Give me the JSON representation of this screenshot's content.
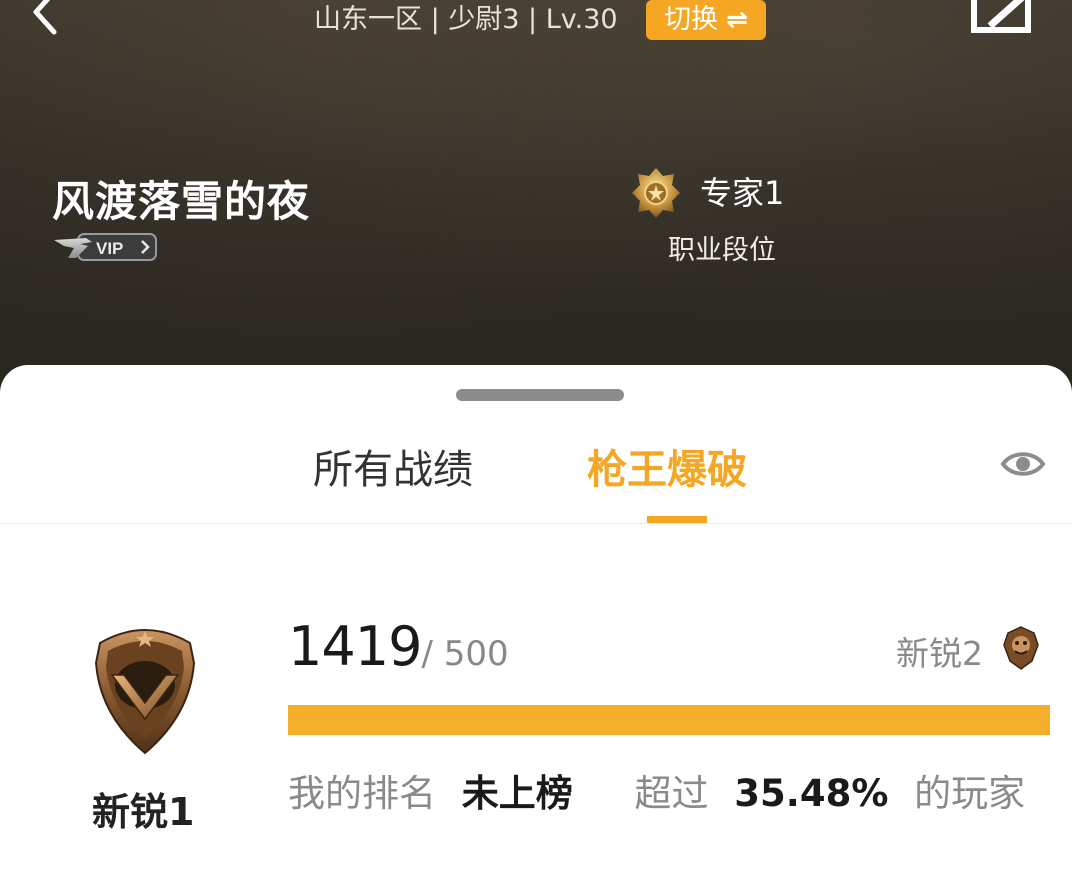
{
  "header": {
    "server_info": "山东一区 | 少尉3 | Lv.30",
    "switch_label": "切换",
    "switch_icon": "⇌",
    "username": "风渡落雪的夜",
    "vip_label": "VIP",
    "pro_rank": "专家1",
    "pro_label": "职业段位",
    "icons": [
      "back-icon",
      "edit-icon",
      "vip-badge-icon",
      "pro-medal-icon"
    ]
  },
  "tabs": [
    {
      "label": "所有战绩",
      "active": false
    },
    {
      "label": "枪王爆破",
      "active": true
    }
  ],
  "rank": {
    "current_name": "新锐1",
    "score": "1419",
    "score_max": "/ 500",
    "progress_fraction": 1.0,
    "next_rank": "新锐2",
    "my_rank_label": "我的排名",
    "my_rank_value": "未上榜",
    "exceed_label": "超过",
    "exceed_value": "35.48%",
    "players_label": "的玩家"
  },
  "colors": {
    "accent": "#f5a623",
    "header_bg": "#2e2a24",
    "text_dark": "#1a1a1a",
    "text_muted": "#8a8a8a"
  }
}
